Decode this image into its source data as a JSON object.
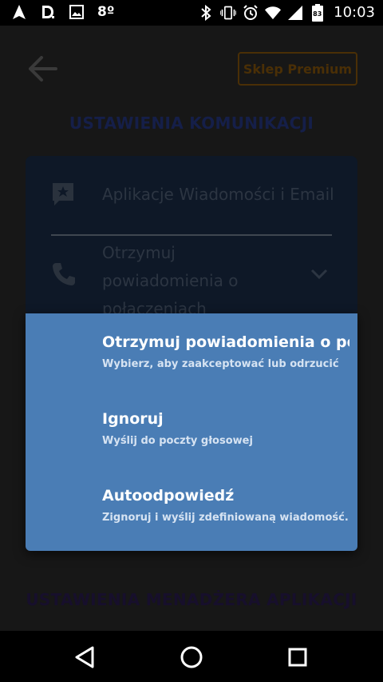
{
  "status_bar": {
    "temperature": "8º",
    "time": "10:03",
    "icons": [
      "navigation-icon",
      "d-icon",
      "image-icon",
      "bluetooth-icon",
      "vibrate-icon",
      "alarm-icon",
      "wifi-icon",
      "signal-icon",
      "battery-icon"
    ],
    "battery_level": "83"
  },
  "header": {
    "premium_label": "Sklep Premium"
  },
  "sections": {
    "communication_title": "USTAWIENIA KOMUNIKACJI",
    "apps_title": "USTAWIENIA MENADŻERA APLIKACJI"
  },
  "settings_card": {
    "messages_label": "Aplikacje Wiadomości i Email",
    "calls_label": "Otrzymuj powiadomienia o połaczeniach"
  },
  "dialog": {
    "options": [
      {
        "title": "Otrzymuj powiadomienia o połącze…",
        "subtitle": "Wybierz, aby zaakceptować lub odrzucić"
      },
      {
        "title": "Ignoruj",
        "subtitle": "Wyślij do poczty głosowej"
      },
      {
        "title": "Autoodpowiedź",
        "subtitle": "Zignoruj i wyślij zdefiniowaną wiadomość."
      }
    ]
  },
  "colors": {
    "dialog_bg": "#4a7db5",
    "premium_accent": "#4a2f06",
    "app_bg": "#171717"
  }
}
